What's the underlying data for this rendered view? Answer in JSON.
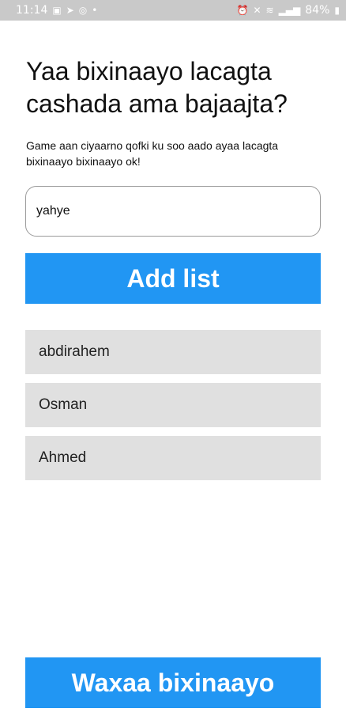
{
  "status_bar": {
    "time": "11:14",
    "left_icons": [
      "gallery-icon",
      "telegram-icon",
      "instagram-icon",
      "dot-icon"
    ],
    "right_icons": [
      "alarm-icon",
      "mute-icon",
      "wifi-icon",
      "signal-icon"
    ],
    "battery": "84%"
  },
  "header": {
    "title": "Yaa bixinaayo lacagta cashada ama bajaajta?",
    "subtitle": "Game aan ciyaarno qofki ku soo aado ayaa lacagta bixinaayo bixinaayo ok!"
  },
  "form": {
    "name_value": "yahye",
    "add_label": "Add list"
  },
  "players": [
    {
      "name": "abdirahem"
    },
    {
      "name": "Osman"
    },
    {
      "name": "Ahmed"
    }
  ],
  "footer": {
    "submit_label": "Waxaa bixinaayo"
  },
  "colors": {
    "accent": "#2196f3",
    "list_bg": "#e0e0e0",
    "status_bar": "#c9c9c9"
  }
}
